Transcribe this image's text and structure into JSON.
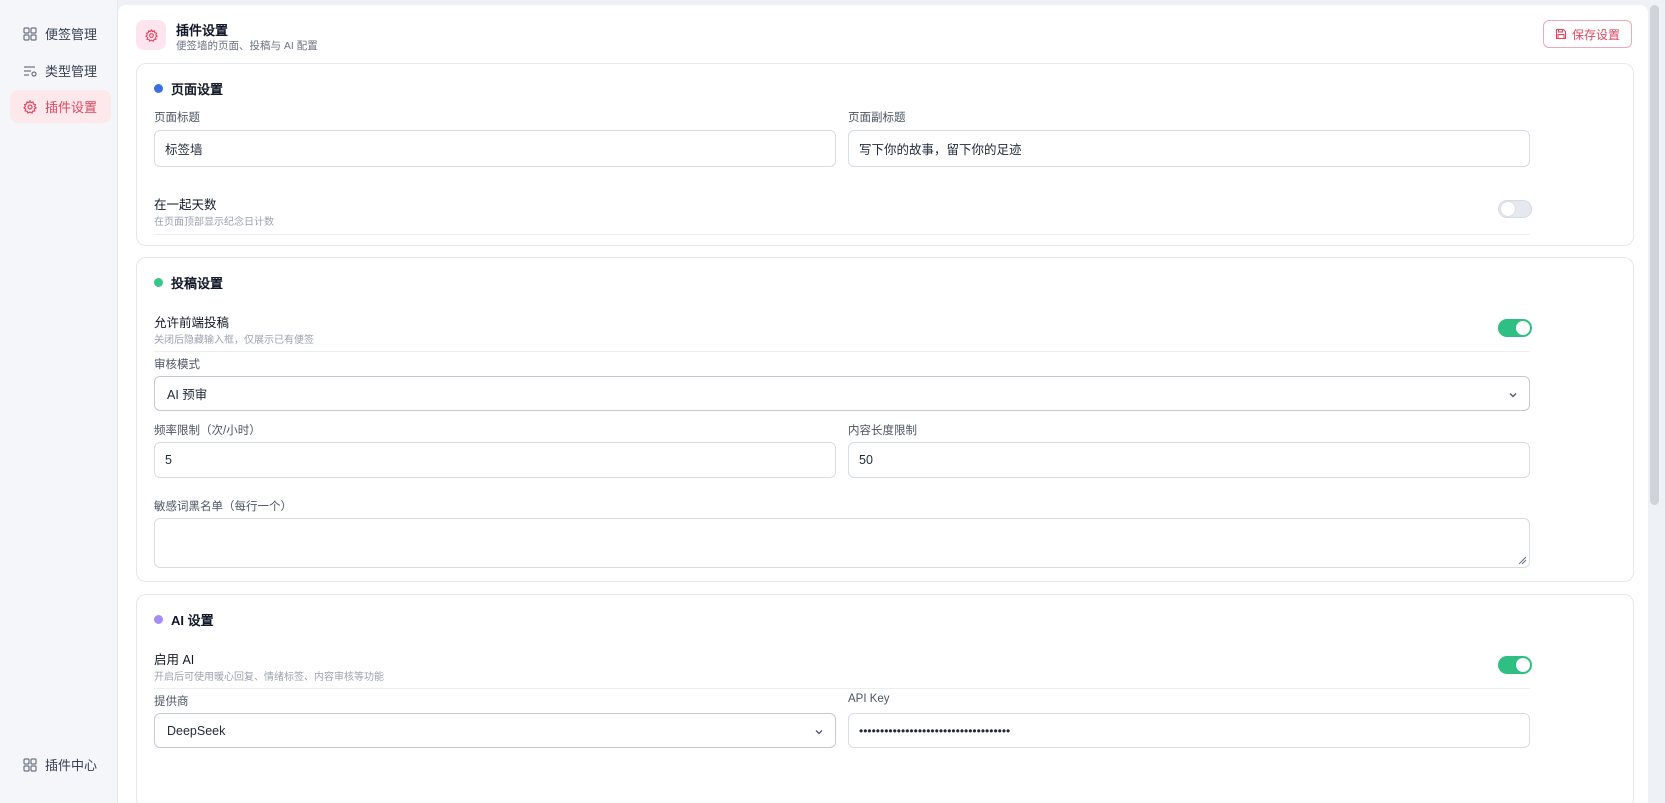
{
  "sidebar": {
    "items": [
      {
        "label": "便签管理",
        "icon": "grid-icon"
      },
      {
        "label": "类型管理",
        "icon": "list-tag-icon"
      },
      {
        "label": "插件设置",
        "icon": "gear-icon",
        "active": true
      }
    ],
    "footer": {
      "label": "插件中心",
      "icon": "grid-icon"
    }
  },
  "header": {
    "title": "插件设置",
    "subtitle": "便签墙的页面、投稿与 AI 配置",
    "save_label": "保存设置"
  },
  "page_settings": {
    "title": "页面设置",
    "page_title_label": "页面标题",
    "page_title_value": "标签墙",
    "page_subtitle_label": "页面副标题",
    "page_subtitle_value": "写下你的故事，留下你的足迹",
    "days_title": "在一起天数",
    "days_desc": "在页面顶部显示纪念日计数",
    "days_enabled": false
  },
  "submission_settings": {
    "title": "投稿设置",
    "allow_title": "允许前端投稿",
    "allow_desc": "关闭后隐藏输入框，仅展示已有便签",
    "allow_enabled": true,
    "review_label": "审核模式",
    "review_value": "AI 预审",
    "rate_label": "频率限制（次/小时）",
    "rate_value": "5",
    "length_label": "内容长度限制",
    "length_value": "50",
    "blacklist_label": "敏感词黑名单（每行一个）",
    "blacklist_value": ""
  },
  "ai_settings": {
    "title": "AI 设置",
    "enable_title": "启用 AI",
    "enable_desc": "开启后可使用暖心回复、情绪标签、内容审核等功能",
    "enable_enabled": true,
    "provider_label": "提供商",
    "provider_value": "DeepSeek",
    "apikey_label": "API Key",
    "apikey_value": "••••••••••••••••••••••••••••••••••••"
  },
  "colors": {
    "accent": "#e0485f",
    "page_dot": "#3b6fe0",
    "submission_dot": "#34c98a",
    "ai_dot": "#a78bfa",
    "toggle_on": "#2fbf82"
  }
}
